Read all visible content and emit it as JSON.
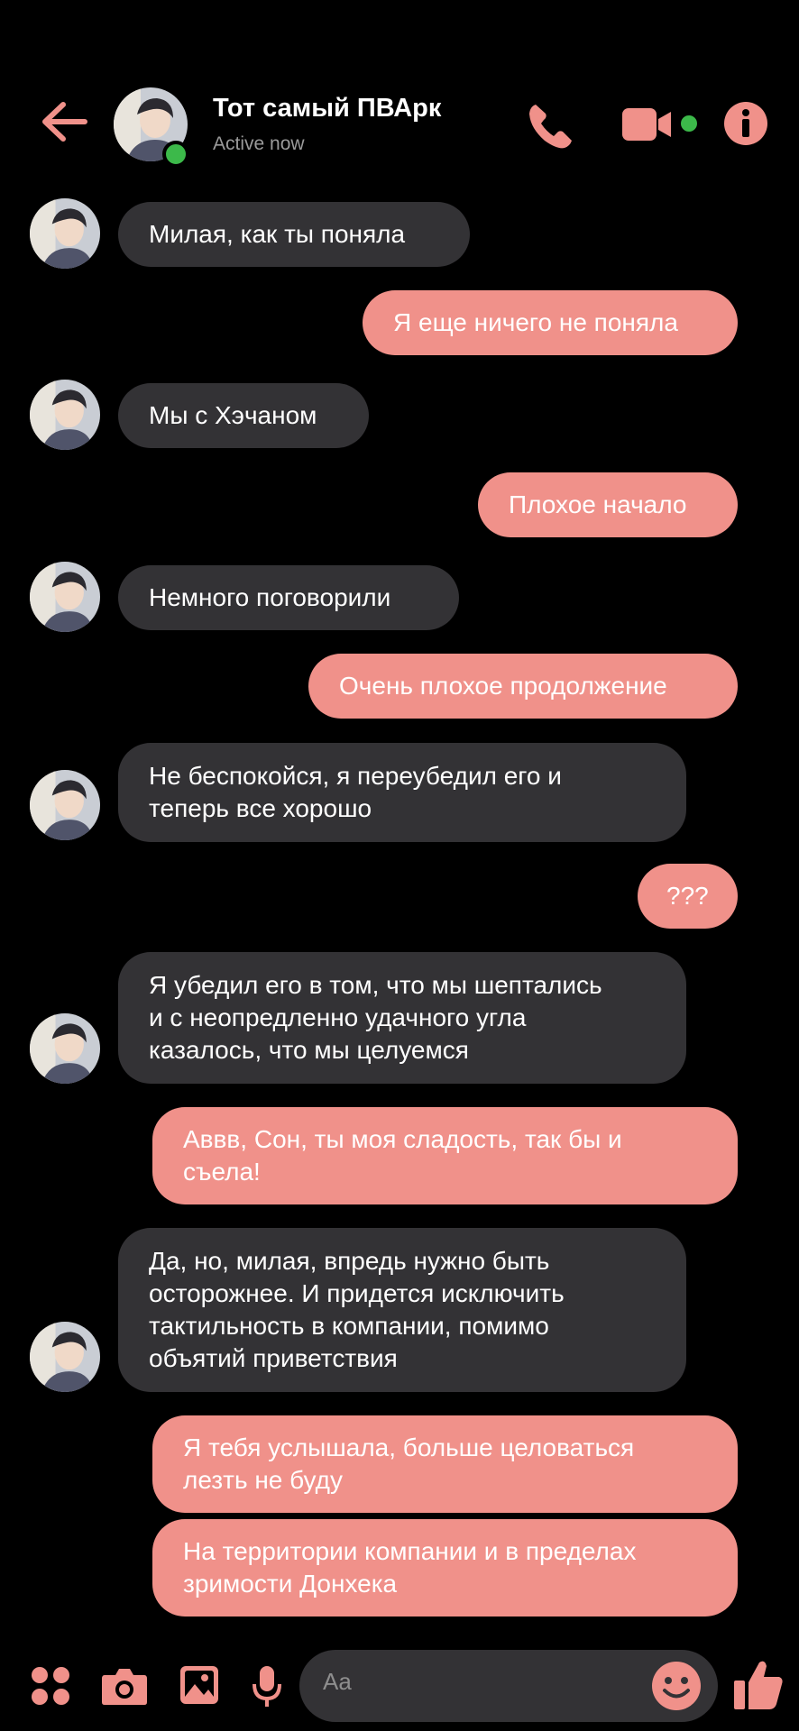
{
  "header": {
    "contact_name": "Тот самый ПВАрк",
    "status": "Active now"
  },
  "colors": {
    "accent": "#f0918a",
    "incoming_bubble": "#333235",
    "online": "#3cb94a",
    "background": "#000000"
  },
  "icons": {
    "back": "arrow-left-icon",
    "call": "phone-icon",
    "video": "video-camera-icon",
    "info": "info-icon",
    "menu": "four-dots-icon",
    "camera": "camera-icon",
    "gallery": "image-icon",
    "voice": "microphone-icon",
    "emoji": "smiley-icon",
    "like": "thumbs-up-icon"
  },
  "messages": [
    {
      "side": "in",
      "text": "Милая, как ты поняла"
    },
    {
      "side": "out",
      "text": "Я еще ничего не поняла"
    },
    {
      "side": "in",
      "text": "Мы с Хэчаном"
    },
    {
      "side": "out",
      "text": "Плохое начало"
    },
    {
      "side": "in",
      "text": "Немного поговорили"
    },
    {
      "side": "out",
      "text": "Очень плохое продолжение"
    },
    {
      "side": "in",
      "text": "Не беспокойся, я переубедил его и\nтеперь все хорошо"
    },
    {
      "side": "out",
      "text": "???"
    },
    {
      "side": "in",
      "text": "Я убедил его в том, что мы шептались\nи с неопредленно удачного угла\nказалось, что мы целуемся"
    },
    {
      "side": "out",
      "text": "Аввв, Сон, ты моя сладость, так бы и\nсъела!"
    },
    {
      "side": "in",
      "text": "Да, но, милая, впредь нужно быть\nосторожнее. И придется исключить\nтактильность в компании, помимо\nобъятий приветствия"
    },
    {
      "side": "out",
      "text": "Я тебя услышала, больше целоваться\nлезть не буду"
    },
    {
      "side": "out",
      "text": "На территории компании и в пределах\nзримости Донхека"
    }
  ],
  "composer": {
    "placeholder": "Aa"
  }
}
